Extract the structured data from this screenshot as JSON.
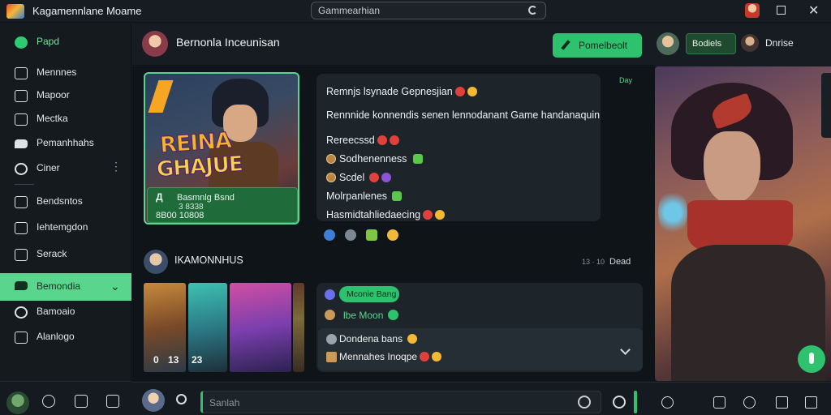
{
  "app": {
    "title": "Kagamennlane Moame",
    "logo_icon": "app-logo-icon"
  },
  "search": {
    "placeholder": "Gammearhian"
  },
  "sidebar": {
    "items": [
      {
        "label": "Papd",
        "icon": "brand-icon"
      },
      {
        "label": "Mennnes",
        "icon": "list-icon"
      },
      {
        "label": "Mapoor",
        "icon": "map-icon"
      },
      {
        "label": "Mectka",
        "icon": "media-icon"
      },
      {
        "label": "Pemanhhahs",
        "icon": "chat-icon"
      },
      {
        "label": "Ciner",
        "icon": "circle-icon",
        "has_menu": true
      },
      {
        "label": "Bendsntos",
        "icon": "box-icon"
      },
      {
        "label": "Iehtemgdon",
        "icon": "page-icon"
      },
      {
        "label": "Serack",
        "icon": "stack-icon"
      },
      {
        "label": "Bemondia",
        "icon": "chat-bubble-icon",
        "active": true,
        "has_menu": true
      },
      {
        "label": "Bamoaio",
        "icon": "ring-icon"
      },
      {
        "label": "Alanlogo",
        "icon": "grid-icon"
      }
    ]
  },
  "chat": {
    "name": "Bernonla Inceunisan",
    "action_button": "Pomelbeolt",
    "right_pill": "Bodiels",
    "right_name": "Dnrise"
  },
  "messages": {
    "card": {
      "title_line1": "REINA",
      "title_line2": "GHAJUE",
      "foot_big": "Д",
      "foot_title": "Basmnlg Bsnd",
      "foot_sub": "3 8338",
      "foot_code": "8B00 10808"
    },
    "bubble_time": "Day",
    "lines": [
      "Remnjs lsynade Gepnesjian",
      "Rennnide konnendis  senen lennodanant Game handanaquin",
      "Rereecssd",
      "Sodhenenness",
      "Scdel",
      "Molrpanlenes",
      "Hasmidtahliedaecing"
    ],
    "second": {
      "author": "IKAMONNHUS",
      "time": "13 · 10",
      "mark": "Dead",
      "thumb_captions": [
        "0",
        "13",
        "23"
      ],
      "pill": "Mconie Bang",
      "green_line": "lbe Moon",
      "inner_lines": [
        "Dondena bans",
        "Mennahes Inoqpe"
      ]
    }
  },
  "composer": {
    "placeholder": "Sanlah"
  },
  "colors": {
    "accent": "#2ec26f",
    "accent_light": "#59d58e",
    "bg": "#0f1418"
  }
}
